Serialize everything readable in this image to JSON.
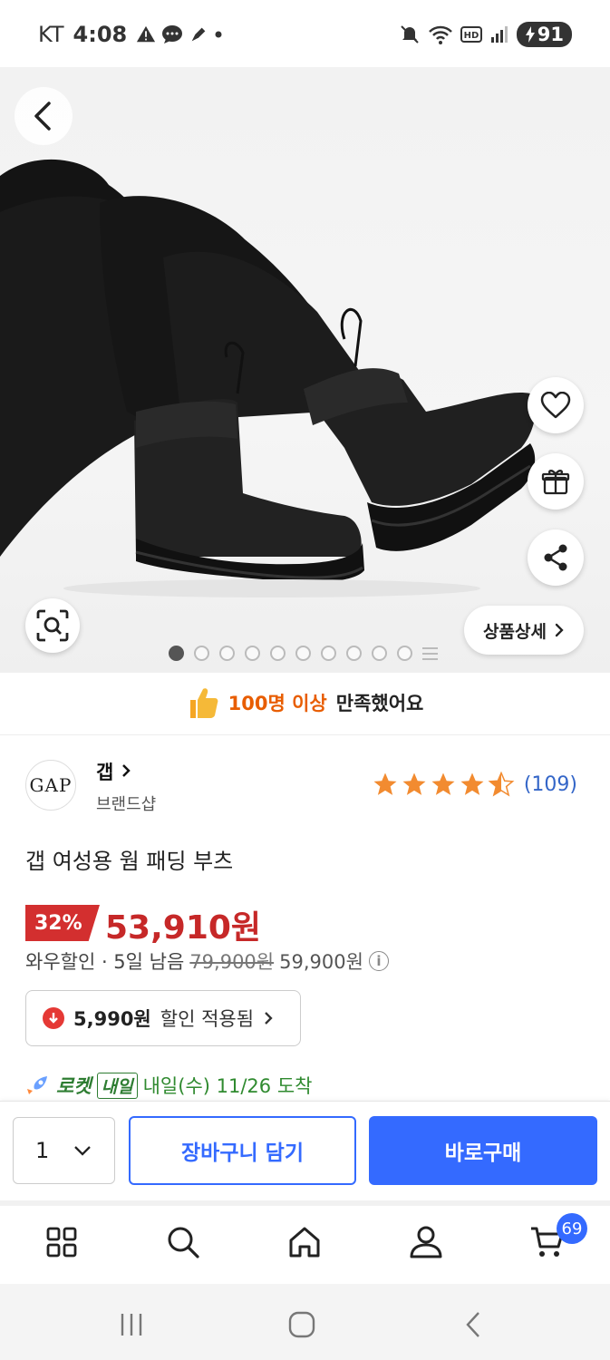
{
  "status_bar": {
    "carrier": "KT",
    "time": "4:08",
    "battery": "91"
  },
  "hero": {
    "detail_button": "상품상세",
    "image_count": 10,
    "active_index": 0
  },
  "satisfaction": {
    "highlight": "100명 이상",
    "text": "만족했어요"
  },
  "brand": {
    "logo_text": "GAP",
    "name": "갭",
    "subtitle": "브랜드샵",
    "rating": 4.5,
    "review_count": "(109)"
  },
  "product": {
    "title": "갭 여성용 웜 패딩 부츠"
  },
  "price": {
    "discount": "32%",
    "sale_price": "53,910원",
    "wow_label": "와우할인 · 5일 남음",
    "strike_price": "79,900원",
    "orig_price": "59,900원",
    "info_icon": "i"
  },
  "coupon": {
    "amount": "5,990원",
    "label": "할인 적용됨"
  },
  "delivery": {
    "rocket": "로켓",
    "tomorrow": "내일",
    "text": "내일(수) 11/26 도착"
  },
  "purchase": {
    "quantity": "1",
    "cart_label": "장바구니 담기",
    "buy_label": "바로구매"
  },
  "bottom_nav": {
    "cart_count": "69"
  },
  "colors": {
    "accent": "#346aff",
    "price_red": "#c62828",
    "rocket_green": "#2e7d32",
    "satisfaction_orange": "#e85d00"
  }
}
